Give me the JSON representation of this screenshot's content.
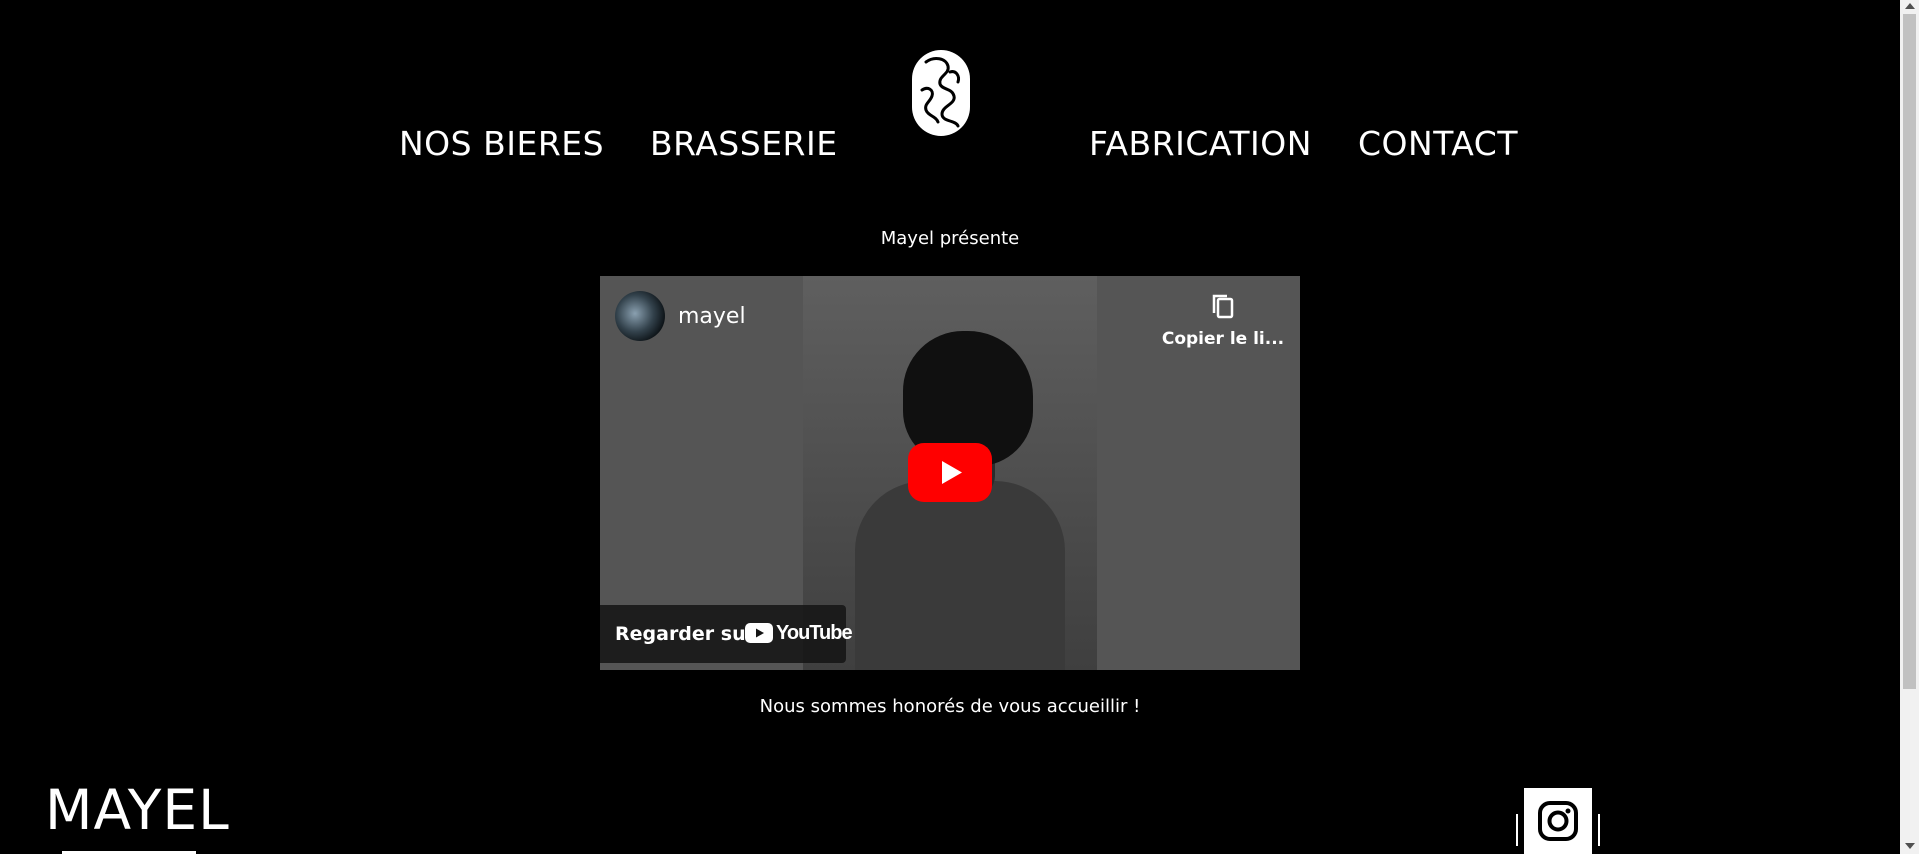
{
  "nav": {
    "items": [
      {
        "label": "NOS BIERES"
      },
      {
        "label": "BRASSERIE"
      },
      {
        "label": "FABRICATION"
      },
      {
        "label": "CONTACT"
      }
    ],
    "logo_icon": "face-line-art-icon"
  },
  "main": {
    "intro": "Mayel présente",
    "video": {
      "channel_name": "mayel",
      "copy_link_label": "Copier le li...",
      "watch_label": "Regarder sur",
      "youtube_wordmark": "YouTube",
      "colors": {
        "play": "#ff0000",
        "overlay": "#141414"
      }
    },
    "welcome": "Nous sommes honorés de vous accueillir !"
  },
  "footer": {
    "brand": "MAYEL",
    "social_icon": "instagram-icon"
  },
  "colors": {
    "background": "#000000",
    "text": "#ffffff"
  }
}
